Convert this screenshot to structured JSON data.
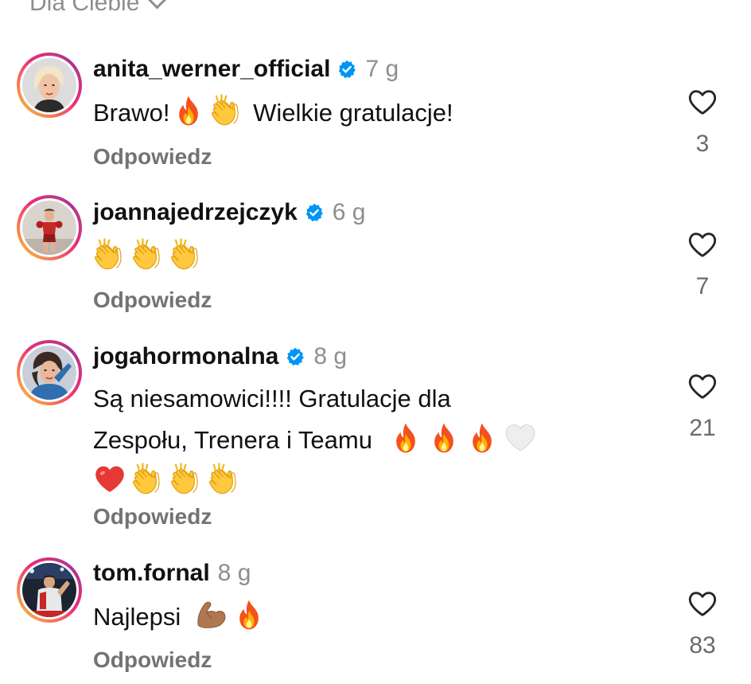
{
  "sort": {
    "label": "Dla Ciebie"
  },
  "comments": [
    {
      "username": "anita_werner_official",
      "verified": true,
      "time": "7 g",
      "text": "Brawo! 🔥👏 Wielkie gratulacje!",
      "reply_label": "Odpowiedz",
      "likes": "3"
    },
    {
      "username": "joannajedrzejczyk",
      "verified": true,
      "time": "6 g",
      "text": "👏👏👏",
      "reply_label": "Odpowiedz",
      "likes": "7"
    },
    {
      "username": "jogahormonalna",
      "verified": true,
      "time": "8 g",
      "text_line1": "Są niesamowici!!!! Gratulacje dla",
      "text_line2": "Zespołu, Trenera i Teamu",
      "reply_label": "Odpowiedz",
      "likes": "21"
    },
    {
      "username": "tom.fornal",
      "verified": false,
      "time": "8 g",
      "text": "Najlepsi",
      "reply_label": "Odpowiedz",
      "likes": "83"
    }
  ],
  "colors": {
    "verified": "#0095f6",
    "muted": "#8e8e8e",
    "text": "#111111"
  },
  "icons": {
    "like": "heart-outline-icon",
    "verified": "verified-badge-icon",
    "sort": "chevron-down-icon"
  }
}
